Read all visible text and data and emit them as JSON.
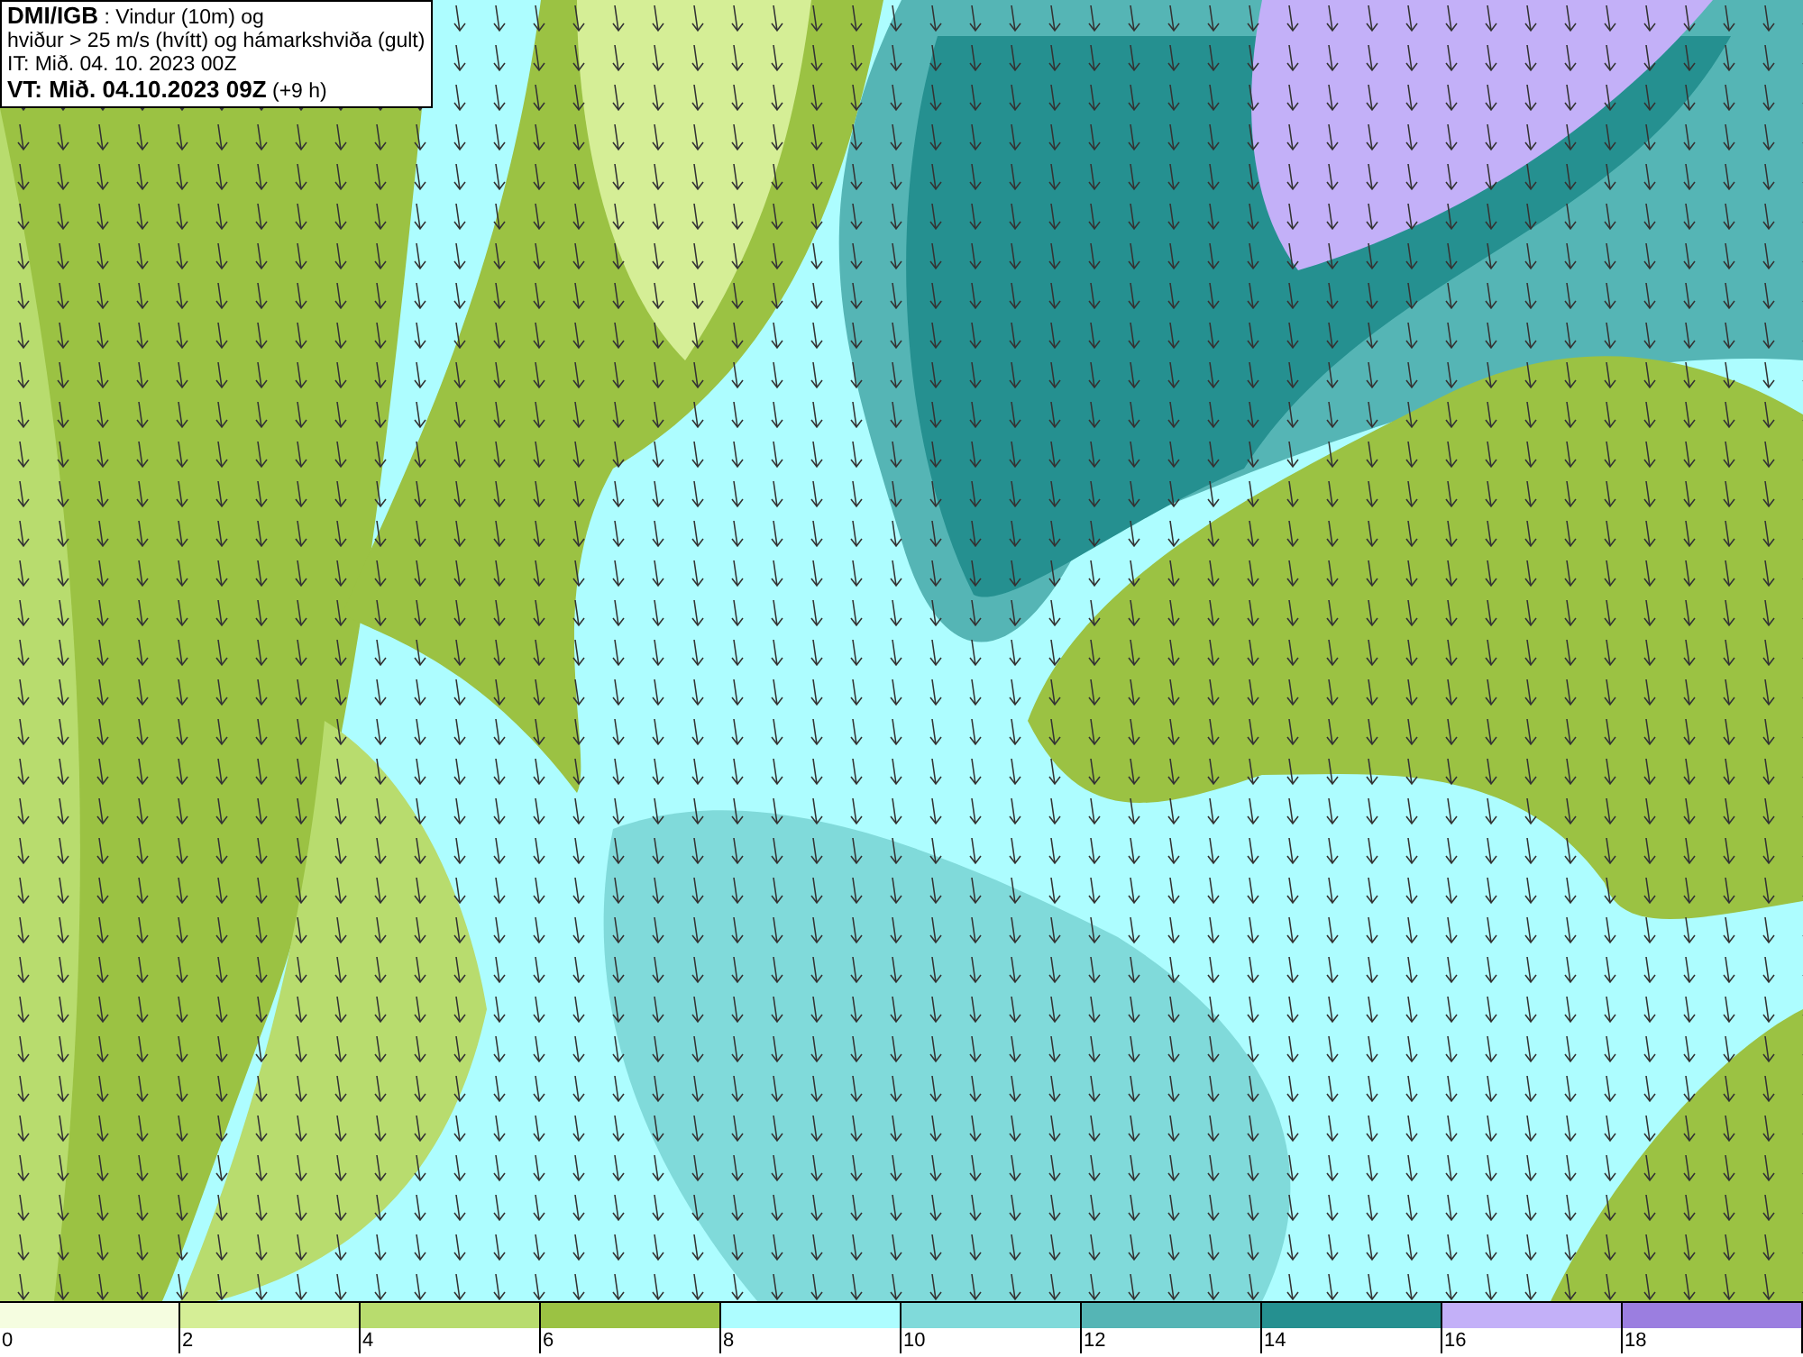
{
  "title_box": {
    "source": "DMI/IGB",
    "description": " : Vindur (10m) og",
    "line_2": "hviður > 25 m/s (hvítt) og hámarkshviða (gult)",
    "issue_time": "IT: Mið. 04. 10. 2023 00Z",
    "valid_time": "VT: Mið. 04.10.2023 09Z",
    "lead": "(+9 h)"
  },
  "legend": [
    {
      "label": "0",
      "color": "#f5fde0"
    },
    {
      "label": "2",
      "color": "#d5ee96"
    },
    {
      "label": "4",
      "color": "#b8dc6e"
    },
    {
      "label": "6",
      "color": "#9bc243"
    },
    {
      "label": "8",
      "color": "#adfdff"
    },
    {
      "label": "10",
      "color": "#80dada"
    },
    {
      "label": "12",
      "color": "#55b5b5"
    },
    {
      "label": "14",
      "color": "#259090"
    },
    {
      "label": "16",
      "color": "#c3b0f8"
    },
    {
      "label": "18",
      "color": "#9b7ee0"
    }
  ]
}
